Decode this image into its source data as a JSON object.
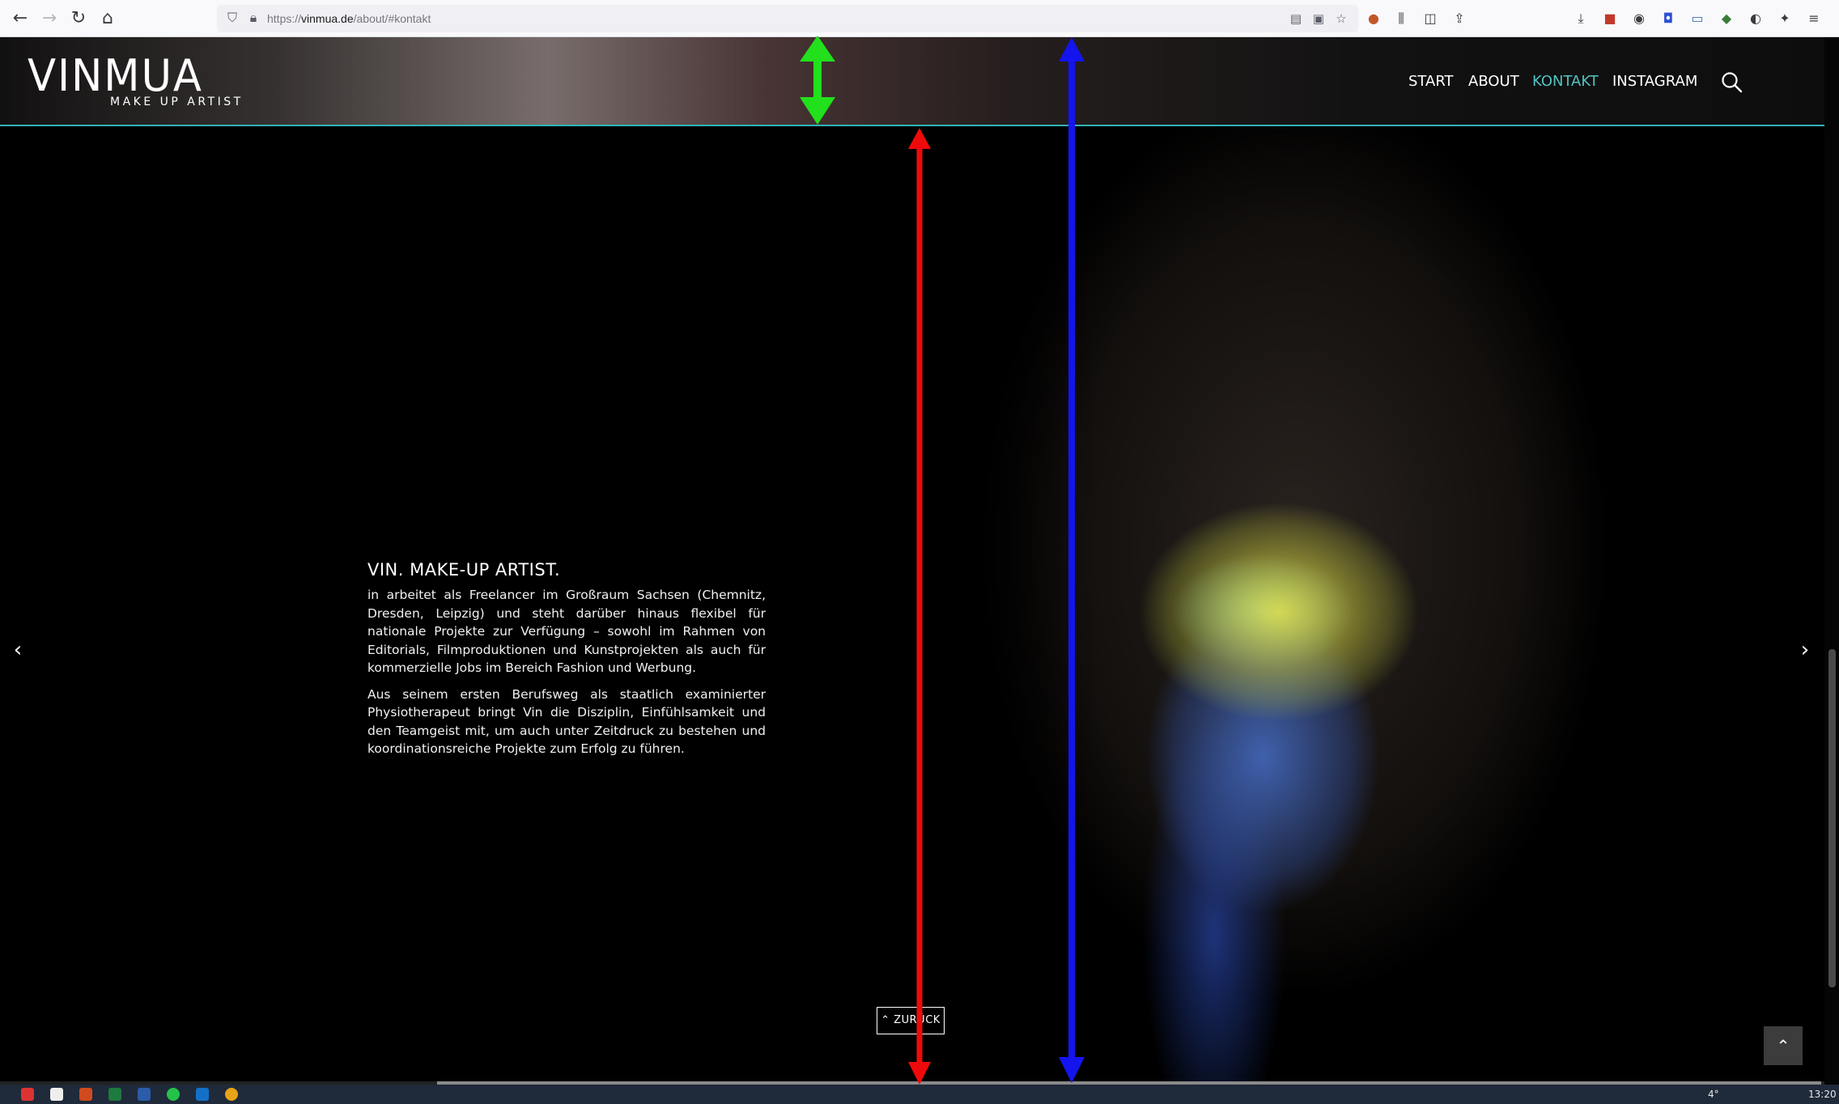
{
  "browser": {
    "url_domain": "vinmua.de",
    "url_path": "/about/#kontakt",
    "url_prefix": "https://"
  },
  "site": {
    "logo_main": "VINMUA",
    "logo_sub": "MAKE UP ARTIST",
    "nav": [
      {
        "label": "START"
      },
      {
        "label": "ABOUT"
      },
      {
        "label": "KONTAKT",
        "active": true
      },
      {
        "label": "INSTAGRAM"
      }
    ]
  },
  "content": {
    "heading": "VIN. MAKE-UP ARTIST.",
    "paragraph_1": "in arbeitet als Freelancer im Großraum Sachsen (Chemnitz, Dres­den, Leipzig) und steht darüber hinaus flexibel für nationale Projekte zur Verfügung – sowohl im Rahmen von Editorials, Filmproduktionen und Kunstprojekten als auch für kommerzielle Jobs im Bereich Fa­shion und Werbung.",
    "paragraph_2": "Aus seinem ersten Berufsweg als staatlich examinierter Physiothera­peut bringt Vin die Disziplin, Einfühlsamkeit und den Teamgeist mit, um auch unter Zeitdruck zu bestehen und koordinationsreiche Pro­jekte zum Erfolg zu führen."
  },
  "controls": {
    "prev_arrow": "‹",
    "next_arrow": "›",
    "back_label": "ZURÜCK",
    "to_top": "⌃"
  },
  "annotations": {
    "green_color": "#22e01c",
    "red_color": "#ee0a0a",
    "blue_color": "#1414ee"
  },
  "taskbar": {
    "time": "13:20",
    "temp": "4°"
  }
}
